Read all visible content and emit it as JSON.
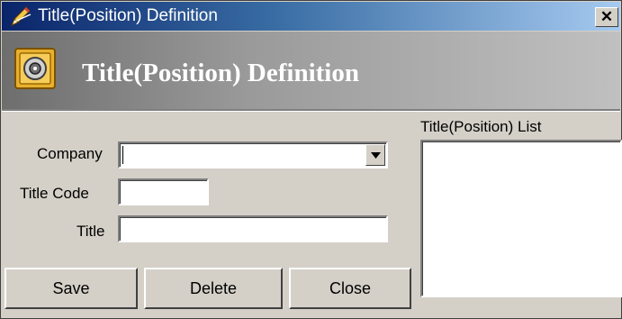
{
  "window": {
    "title": "Title(Position) Definition",
    "close_glyph": "✕"
  },
  "header": {
    "title": "Title(Position) Definition",
    "icon": "safe-icon"
  },
  "form": {
    "company_label": "Company",
    "company_value": "",
    "title_code_label": "Title Code",
    "title_code_value": "",
    "title_label": "Title",
    "title_value": ""
  },
  "list": {
    "label": "Title(Position) List",
    "items": []
  },
  "buttons": {
    "save": "Save",
    "delete": "Delete",
    "close": "Close"
  },
  "colors": {
    "titlebar_start": "#0a246a",
    "titlebar_end": "#a6caf0",
    "window_bg": "#d4d0c8",
    "header_bg": "#9a9a9a"
  }
}
